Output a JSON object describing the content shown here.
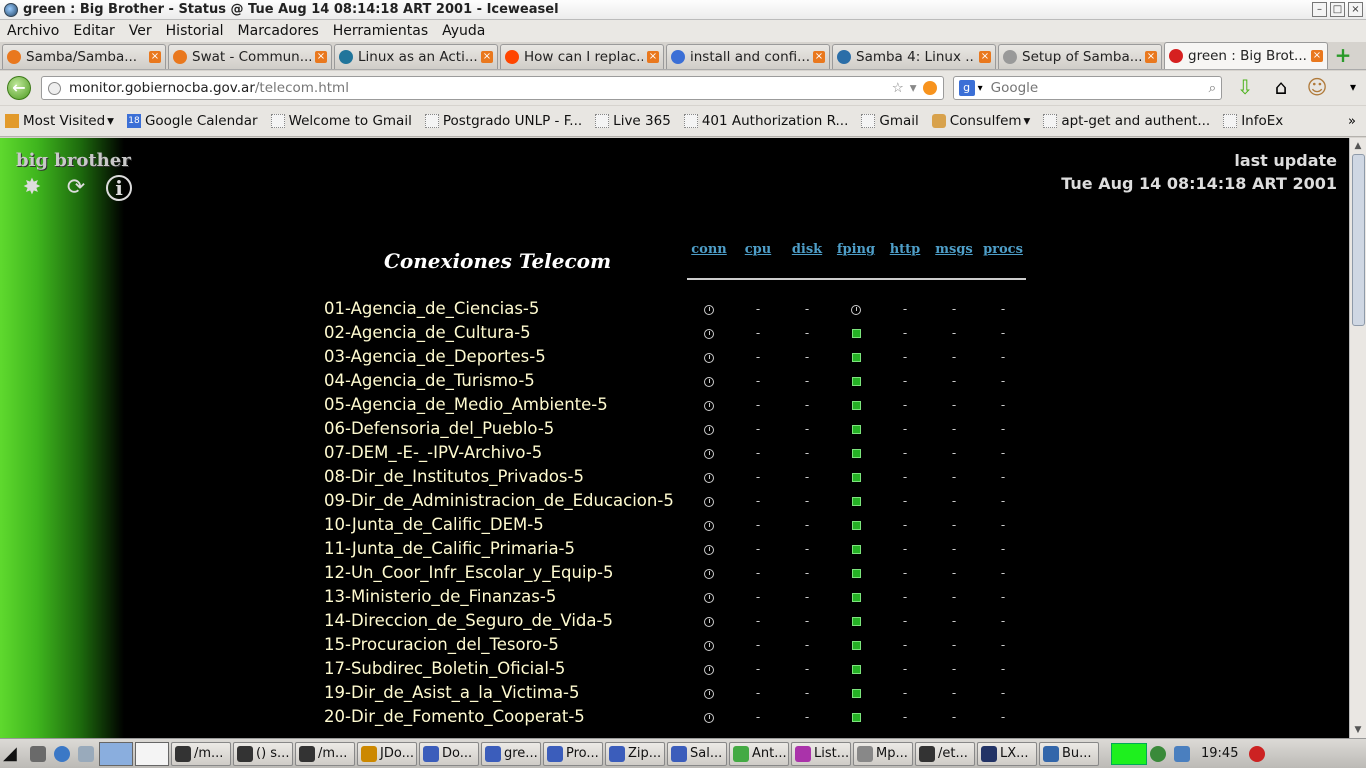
{
  "window": {
    "title": "green : Big Brother - Status @ Tue Aug 14 08:14:18 ART 2001 - Iceweasel"
  },
  "menu": [
    "Archivo",
    "Editar",
    "Ver",
    "Historial",
    "Marcadores",
    "Herramientas",
    "Ayuda"
  ],
  "tabs": [
    {
      "label": "Samba/Samba...",
      "icon": "ubuntu-icon",
      "color": "#e9781e"
    },
    {
      "label": "Swat - Commun...",
      "icon": "ubuntu-icon",
      "color": "#e9781e"
    },
    {
      "label": "Linux as an Acti...",
      "icon": "wordpress-icon",
      "color": "#21759b"
    },
    {
      "label": "How can I replac...",
      "icon": "reddit-icon",
      "color": "#ff4500"
    },
    {
      "label": "install and confi...",
      "icon": "google-icon",
      "color": "#3b6fd6"
    },
    {
      "label": "Samba 4: Linux ...",
      "icon": "site-icon",
      "color": "#2b6ea8"
    },
    {
      "label": "Setup of Samba...",
      "icon": "blank-page-icon",
      "color": "#999999"
    },
    {
      "label": "green : Big Brot...",
      "icon": "bigbrother-icon",
      "color": "#d62020"
    }
  ],
  "nav": {
    "url_host": "monitor.gobiernocba.gov.ar",
    "url_path": "/telecom.html",
    "search_placeholder": "Google"
  },
  "bookmarks": [
    "Most Visited",
    "Google Calendar",
    "Welcome to Gmail",
    "Postgrado UNLP - F...",
    "Live 365",
    "401 Authorization R...",
    "Gmail",
    "Consulfem",
    "apt-get and authent...",
    "InfoEx"
  ],
  "page": {
    "brand": "big brother",
    "last_update_label": "last update",
    "last_update_time": "Tue Aug 14 08:14:18 ART 2001",
    "title": "Conexiones Telecom",
    "columns": [
      "conn",
      "cpu",
      "disk",
      "fping",
      "http",
      "msgs",
      "procs"
    ],
    "status_colors": {
      "green": "#25b125",
      "clear": "#cccccc"
    },
    "hosts": [
      {
        "name": "01-Agencia_de_Ciencias-5",
        "conn": "clear",
        "fping": "clear"
      },
      {
        "name": "02-Agencia_de_Cultura-5",
        "conn": "clear",
        "fping": "green"
      },
      {
        "name": "03-Agencia_de_Deportes-5",
        "conn": "clear",
        "fping": "green"
      },
      {
        "name": "04-Agencia_de_Turismo-5",
        "conn": "clear",
        "fping": "green"
      },
      {
        "name": "05-Agencia_de_Medio_Ambiente-5",
        "conn": "clear",
        "fping": "green"
      },
      {
        "name": "06-Defensoria_del_Pueblo-5",
        "conn": "clear",
        "fping": "green"
      },
      {
        "name": "07-DEM_-E-_-IPV-Archivo-5",
        "conn": "clear",
        "fping": "green"
      },
      {
        "name": "08-Dir_de_Institutos_Privados-5",
        "conn": "clear",
        "fping": "green"
      },
      {
        "name": "09-Dir_de_Administracion_de_Educacion-5",
        "conn": "clear",
        "fping": "green"
      },
      {
        "name": "10-Junta_de_Calific_DEM-5",
        "conn": "clear",
        "fping": "green"
      },
      {
        "name": "11-Junta_de_Calific_Primaria-5",
        "conn": "clear",
        "fping": "green"
      },
      {
        "name": "12-Un_Coor_Infr_Escolar_y_Equip-5",
        "conn": "clear",
        "fping": "green"
      },
      {
        "name": "13-Ministerio_de_Finanzas-5",
        "conn": "clear",
        "fping": "green"
      },
      {
        "name": "14-Direccion_de_Seguro_de_Vida-5",
        "conn": "clear",
        "fping": "green"
      },
      {
        "name": "15-Procuracion_del_Tesoro-5",
        "conn": "clear",
        "fping": "green"
      },
      {
        "name": "17-Subdirec_Boletin_Oficial-5",
        "conn": "clear",
        "fping": "green"
      },
      {
        "name": "19-Dir_de_Asist_a_la_Victima-5",
        "conn": "clear",
        "fping": "green"
      },
      {
        "name": "20-Dir_de_Fomento_Cooperat-5",
        "conn": "clear",
        "fping": "green"
      }
    ],
    "dash": "-"
  },
  "taskbar": {
    "items": [
      "/m...",
      "() s...",
      "/m...",
      "JDo...",
      "Do...",
      "gre...",
      "Pro...",
      "Zip...",
      "Sal...",
      "Ant...",
      "List...",
      "Mp...",
      "/et...",
      "LX...",
      "Bu..."
    ],
    "clock": "19:45"
  }
}
